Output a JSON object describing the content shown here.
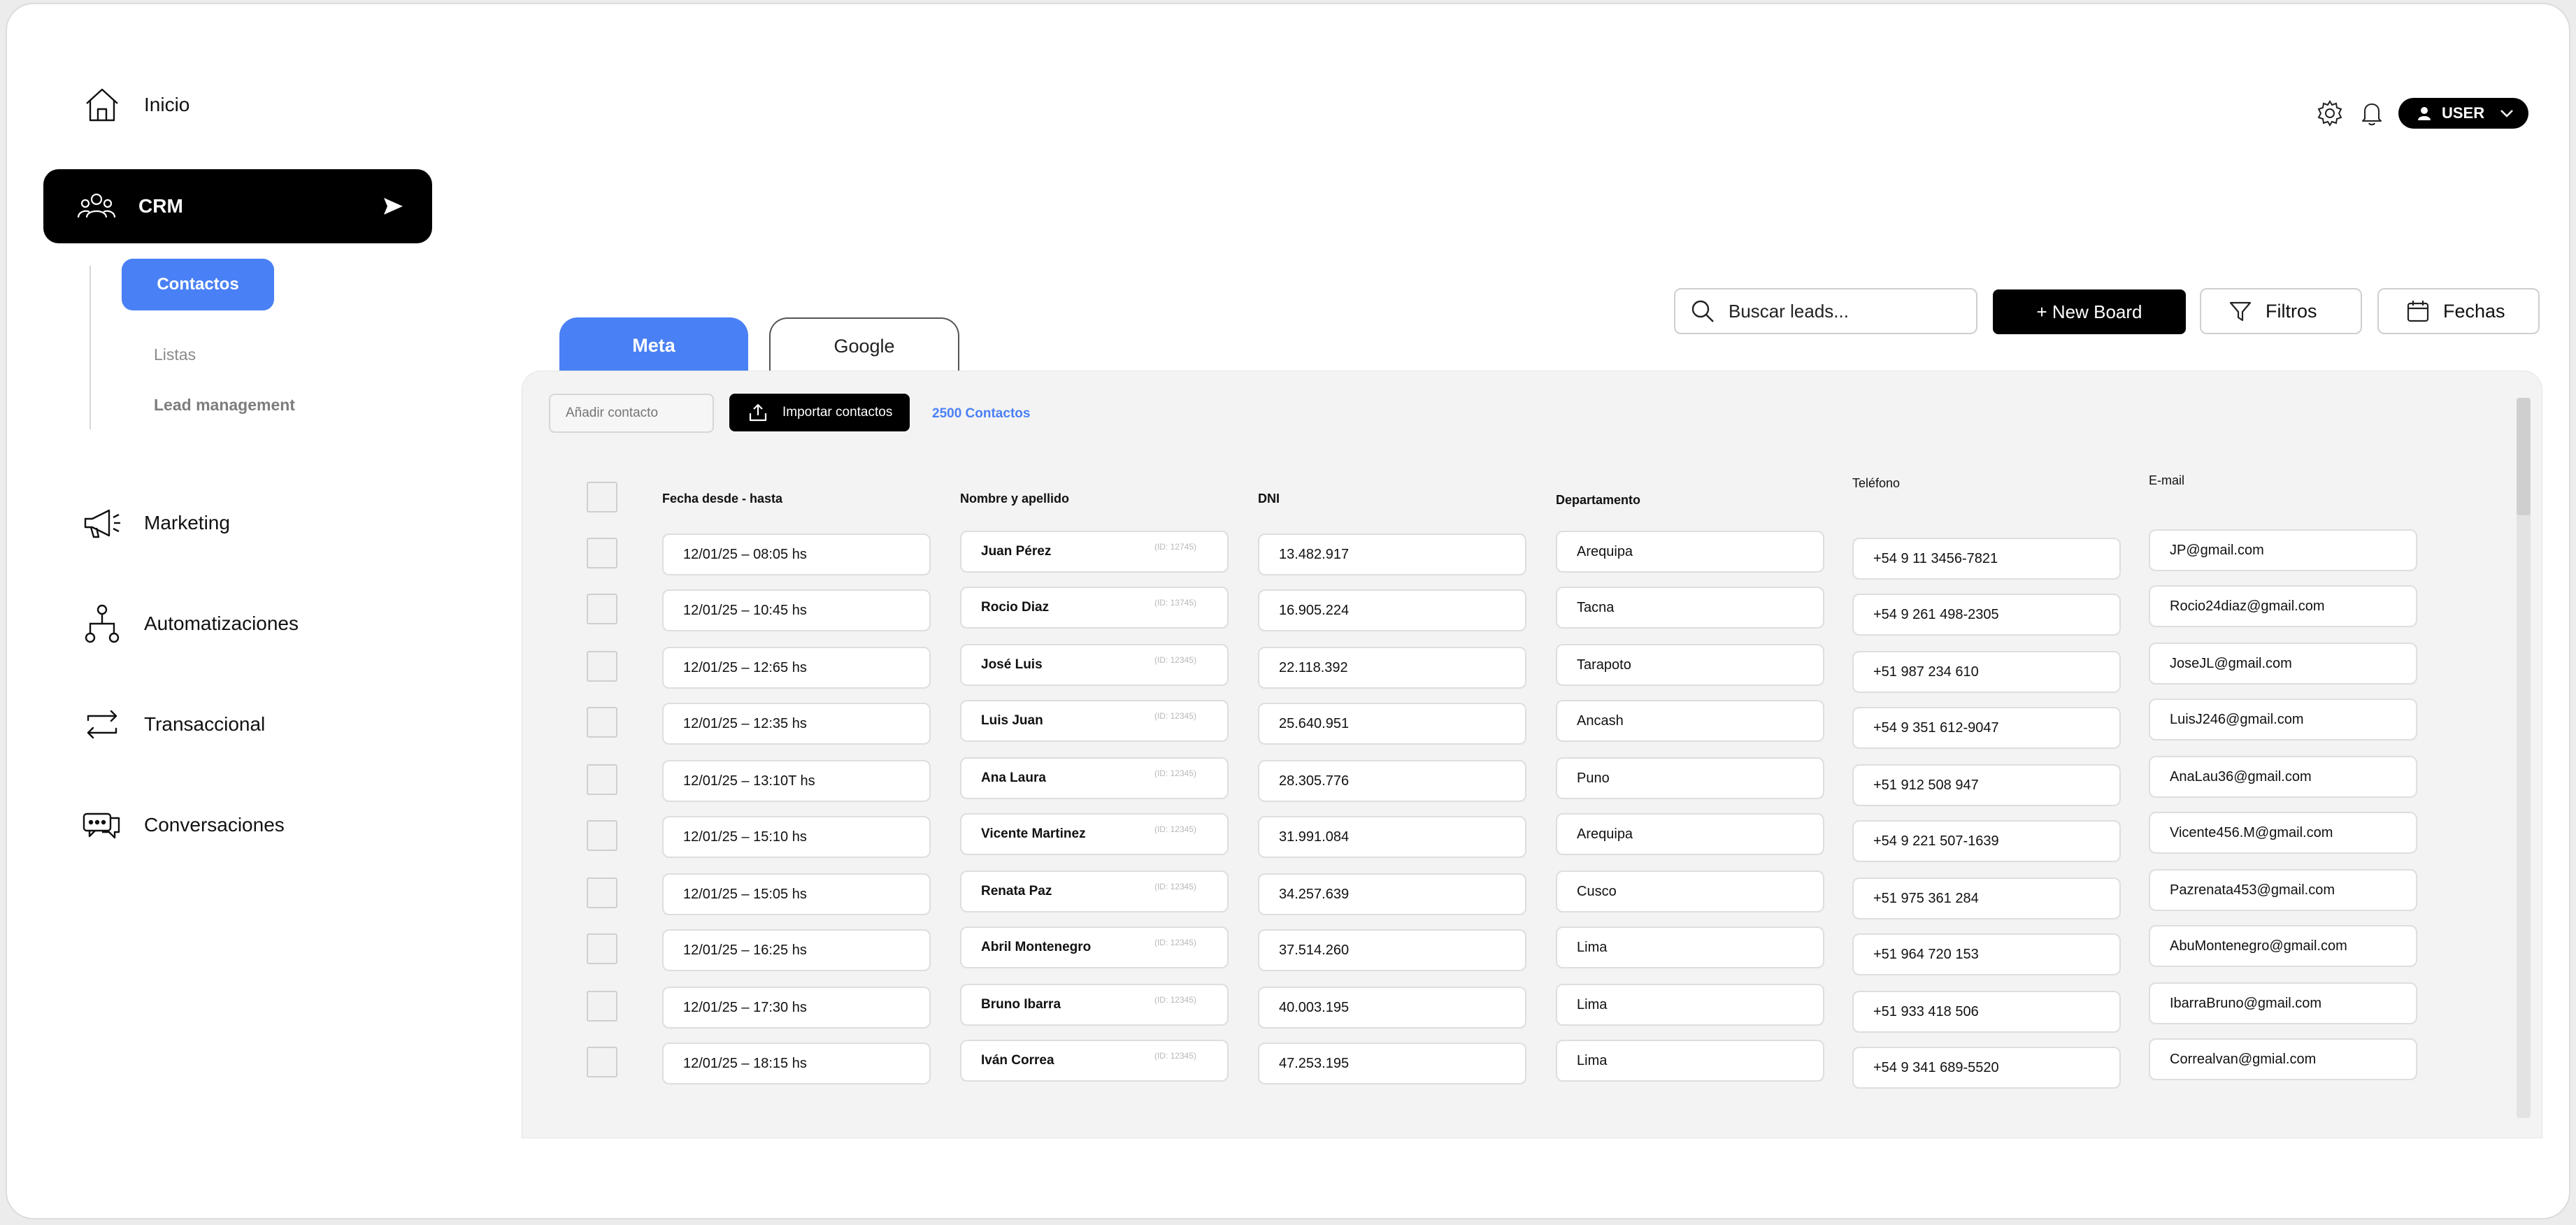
{
  "sidebar": {
    "inicio": "Inicio",
    "crm": "CRM",
    "submenu": {
      "contactos": "Contactos",
      "listas": "Listas",
      "lead_management": "Lead management"
    },
    "marketing": "Marketing",
    "automatizaciones": "Automatizaciones",
    "transaccional": "Transaccional",
    "conversaciones": "Conversaciones"
  },
  "header": {
    "user_label": "USER"
  },
  "toolbar": {
    "search_placeholder": "Buscar leads...",
    "new_board": "+ New Board",
    "filtros": "Filtros",
    "fechas": "Fechas"
  },
  "tabs": {
    "meta": "Meta",
    "google": "Google"
  },
  "panel": {
    "add_contact_placeholder": "Añadir contacto",
    "import_label": "Importar contactos",
    "count_label": "2500 Contactos"
  },
  "table": {
    "headers": {
      "fecha": "Fecha desde - hasta",
      "nombre": "Nombre y apellido",
      "dni": "DNI",
      "departamento": "Departamento",
      "telefono": "Teléfono",
      "email": "E-mail"
    },
    "rows": [
      {
        "fecha": "12/01/25 – 08:05 hs",
        "nombre": "Juan Pérez",
        "id": "(ID: 12745)",
        "dni": "13.482.917",
        "dep": "Arequipa",
        "tel": "+54 9 11 3456-7821",
        "email": "JP@gmail.com"
      },
      {
        "fecha": "12/01/25 – 10:45 hs",
        "nombre": "Rocio Diaz",
        "id": "(ID: 13745)",
        "dni": "16.905.224",
        "dep": "Tacna",
        "tel": "+54 9 261 498-2305",
        "email": "Rocio24diaz@gmail.com"
      },
      {
        "fecha": "12/01/25 – 12:65 hs",
        "nombre": "José Luis",
        "id": "(ID: 12345)",
        "dni": "22.118.392",
        "dep": "Tarapoto",
        "tel": "+51 987 234 610",
        "email": "JoseJL@gmail.com"
      },
      {
        "fecha": "12/01/25 – 12:35 hs",
        "nombre": "Luis Juan",
        "id": "(ID: 12345)",
        "dni": "25.640.951",
        "dep": "Ancash",
        "tel": "+54 9 351 612-9047",
        "email": "LuisJ246@gmail.com"
      },
      {
        "fecha": "12/01/25 – 13:10T hs",
        "nombre": "Ana Laura",
        "id": "(ID: 12345)",
        "dni": "28.305.776",
        "dep": "Puno",
        "tel": "+51 912 508 947",
        "email": "AnaLau36@gmail.com"
      },
      {
        "fecha": "12/01/25 – 15:10 hs",
        "nombre": "Vicente Martinez",
        "id": "(ID: 12345)",
        "dni": "31.991.084",
        "dep": "Arequipa",
        "tel": "+54 9 221 507-1639",
        "email": "Vicente456.M@gmail.com"
      },
      {
        "fecha": "12/01/25 – 15:05 hs",
        "nombre": "Renata Paz",
        "id": "(ID: 12345)",
        "dni": "34.257.639",
        "dep": "Cusco",
        "tel": "+51 975 361 284",
        "email": "Pazrenata453@gmail.com"
      },
      {
        "fecha": "12/01/25 – 16:25 hs",
        "nombre": "Abril Montenegro",
        "id": "(ID: 12345)",
        "dni": "37.514.260",
        "dep": "Lima",
        "tel": "+51 964 720 153",
        "email": "AbuMontenegro@gmail.com"
      },
      {
        "fecha": "12/01/25 – 17:30 hs",
        "nombre": "Bruno Ibarra",
        "id": "(ID: 12345)",
        "dni": "40.003.195",
        "dep": "Lima",
        "tel": "+51 933 418 506",
        "email": "IbarraBruno@gmail.com"
      },
      {
        "fecha": "12/01/25 – 18:15 hs",
        "nombre": "Iván Correa",
        "id": "(ID: 12345)",
        "dni": "47.253.195",
        "dep": "Lima",
        "tel": "+54 9 341 689-5520",
        "email": "Correalvan@gmial.com"
      }
    ]
  },
  "colors": {
    "accent": "#4a80f5",
    "black": "#000000",
    "panel": "#f3f3f3"
  }
}
